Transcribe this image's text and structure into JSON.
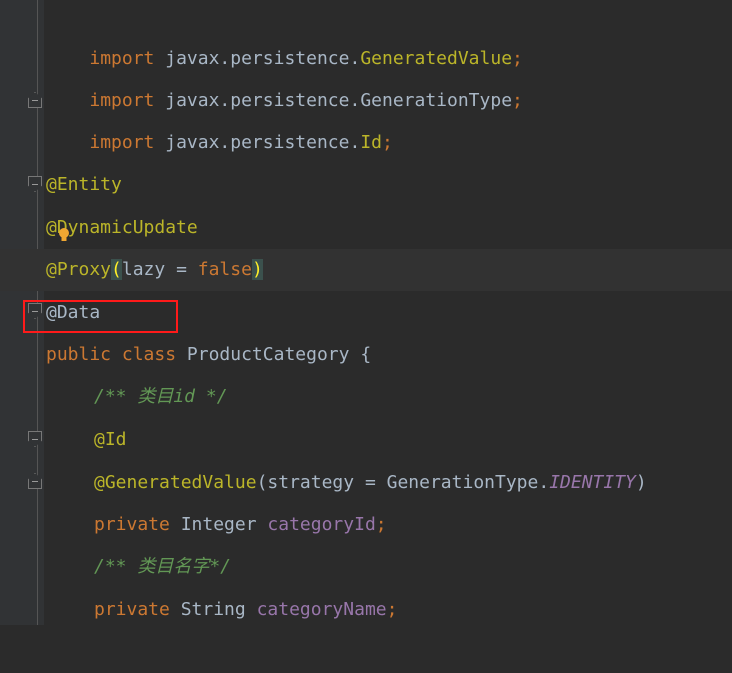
{
  "editor": {
    "lines": [
      {
        "kw": "import",
        "pkg": "javax.persistence.",
        "cls": "GeneratedValue",
        "semi": ";"
      },
      {
        "kw": "import",
        "pkg": "javax.persistence.",
        "cls": "GenerationType",
        "semi": ";"
      },
      {
        "kw": "import",
        "pkg": "javax.persistence.",
        "cls": "Id",
        "semi": ";"
      },
      {},
      {
        "anno": "@Entity"
      },
      {
        "anno": "@DynamicUpdate"
      },
      {
        "anno": "@Proxy",
        "open": "(",
        "arg": "lazy",
        "eq": " = ",
        "val": "false",
        "close": ")"
      },
      {
        "anno": "@Data"
      },
      {
        "kw": "public",
        "kw2": "class",
        "name": "ProductCategory",
        "brace": "{"
      },
      {
        "doc": "/** 类目id */"
      },
      {
        "anno": "@Id"
      },
      {
        "anno": "@GeneratedValue",
        "open": "(",
        "arg": "strategy",
        "eq": " = ",
        "type": "GenerationType.",
        "static": "IDENTITY",
        "close": ")"
      },
      {
        "kw": "private",
        "type": "Integer",
        "field": "categoryId",
        "semi": ";"
      },
      {
        "doc": "/** 类目名字*/"
      },
      {
        "kw": "private",
        "type": "String",
        "field": "categoryName",
        "semi": ";"
      }
    ]
  },
  "colors": {
    "background": "#2b2b2b",
    "keyword": "#cc7832",
    "annotation": "#bbb529",
    "field": "#9876aa",
    "doc_comment": "#629755",
    "highlight_box": "#ff1a1a"
  },
  "icons": {
    "intention": "lightbulb-icon",
    "fold": "fold-marker-icon"
  }
}
